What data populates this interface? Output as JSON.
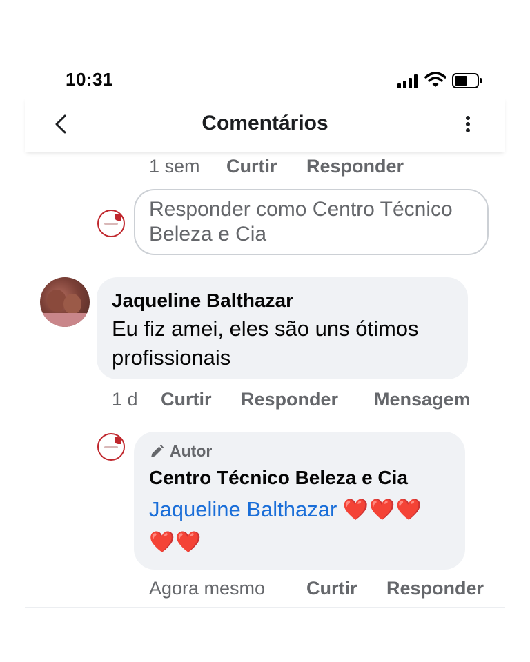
{
  "status_bar": {
    "time": "10:31",
    "icons": [
      "cellular-signal-icon",
      "wifi-icon",
      "battery-icon"
    ]
  },
  "header": {
    "title": "Comentários",
    "back_icon": "chevron-left-icon",
    "menu_icon": "more-vertical-icon"
  },
  "previous_comment_actions": {
    "time": "1 sem",
    "like": "Curtir",
    "reply": "Responder"
  },
  "reply_input": {
    "placeholder": "Responder como Centro Técnico Beleza e Cia"
  },
  "comments": [
    {
      "author": "Jaqueline Balthazar",
      "text": "Eu fiz amei, eles são uns ótimos profissionais",
      "time": "1 d",
      "actions": [
        "Curtir",
        "Responder",
        "Mensagem"
      ],
      "replies": [
        {
          "badge": "Autor",
          "author": "Centro Técnico Beleza e Cia",
          "mention": "Jaqueline Balthazar",
          "emoji_line1": "❤️❤️❤️",
          "emoji_line2": "❤️❤️",
          "time": "Agora mesmo",
          "actions": [
            "Curtir",
            "Responder"
          ]
        }
      ]
    }
  ],
  "colors": {
    "link": "#1a6ed8",
    "secondary_text": "#65676b",
    "bubble": "#f0f2f5",
    "page_avatar_ring": "#c0272d"
  }
}
